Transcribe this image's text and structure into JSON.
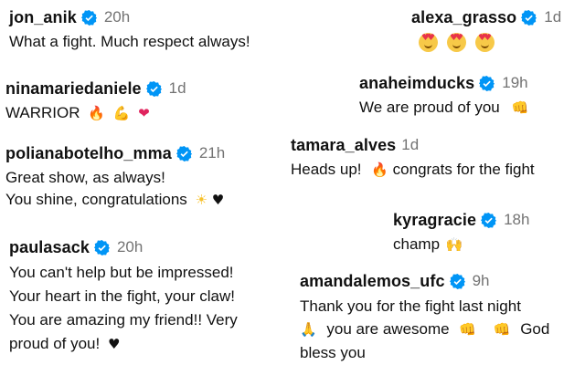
{
  "accent_color": "#0095f6",
  "comments": [
    {
      "user": "jon_anik",
      "verified": true,
      "time": "20h",
      "lines": [
        "What a fight. Much respect always!"
      ]
    },
    {
      "user": "ninamariedaniele",
      "verified": true,
      "time": "1d",
      "lines": [
        "WARRIOR"
      ],
      "emojis": [
        "🔥",
        "💪",
        "❤"
      ]
    },
    {
      "user": "polianabotelho_mma",
      "verified": true,
      "time": "21h",
      "lines": [
        "Great show, as always!",
        "You shine, congratulations"
      ],
      "emojis": [
        "☀",
        "♥"
      ]
    },
    {
      "user": "paulasack",
      "verified": true,
      "time": "20h",
      "lines": [
        "You can't help but be impressed!",
        "Your heart in the fight, your claw!",
        "You are amazing my friend!! Very",
        "proud of you!"
      ],
      "emojis": [
        "♥"
      ]
    },
    {
      "user": "alexa_grasso",
      "verified": true,
      "time": "1d",
      "lines": [],
      "emojis": [
        "heart-eyes-face",
        "heart-eyes-face",
        "heart-eyes-face"
      ]
    },
    {
      "user": "anaheimducks",
      "verified": true,
      "time": "19h",
      "lines": [
        "We are proud of you"
      ],
      "emojis": [
        "👊"
      ]
    },
    {
      "user": "tamara_alves",
      "verified": false,
      "time": "1d",
      "line_a": "Heads up!",
      "line_b": "congrats for the fight",
      "emojis": [
        "🔥"
      ]
    },
    {
      "user": "kyragracie",
      "verified": true,
      "time": "18h",
      "lines": [
        "champ"
      ],
      "emojis": [
        "🙌"
      ]
    },
    {
      "user": "amandalemos_ufc",
      "verified": true,
      "time": "9h",
      "line_1": "Thank you for the fight last night",
      "line_2a": "you are awesome",
      "line_2b": "God",
      "line_3": "bless you",
      "emojis": [
        "🙏",
        "👊",
        "👊"
      ]
    }
  ]
}
